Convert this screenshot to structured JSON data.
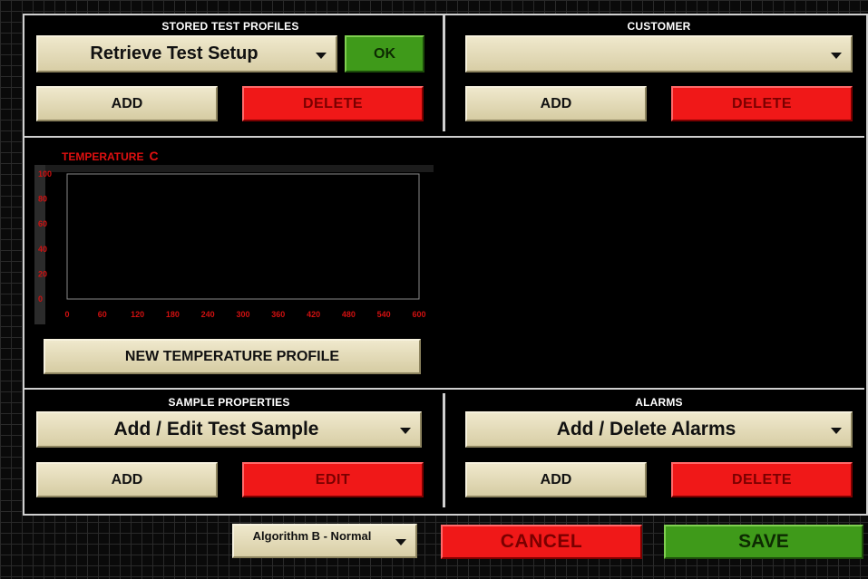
{
  "stored_profiles": {
    "title": "STORED TEST PROFILES",
    "dropdown_value": "Retrieve Test Setup",
    "ok_label": "OK",
    "add_label": "ADD",
    "delete_label": "DELETE"
  },
  "customer": {
    "title": "CUSTOMER",
    "dropdown_value": "",
    "add_label": "ADD",
    "delete_label": "DELETE"
  },
  "temperature": {
    "title": "TEMPERATURE",
    "unit": "C",
    "new_profile_label": "NEW TEMPERATURE PROFILE",
    "chart_data": {
      "type": "line",
      "title": "TEMPERATURE C",
      "x_ticks": [
        0,
        60,
        120,
        180,
        240,
        300,
        360,
        420,
        480,
        540,
        600
      ],
      "y_ticks": [
        0,
        20,
        40,
        60,
        80,
        100
      ],
      "xlim": [
        0,
        600
      ],
      "ylim": [
        0,
        100
      ],
      "series": [],
      "grid": false
    }
  },
  "sample_properties": {
    "title": "SAMPLE PROPERTIES",
    "dropdown_value": "Add / Edit Test Sample",
    "add_label": "ADD",
    "edit_label": "EDIT"
  },
  "alarms": {
    "title": "ALARMS",
    "dropdown_value": "Add / Delete Alarms",
    "add_label": "ADD",
    "delete_label": "DELETE"
  },
  "footer": {
    "algorithm_value": "Algorithm B - Normal",
    "cancel_label": "CANCEL",
    "save_label": "SAVE"
  },
  "colors": {
    "accent_red": "#f01818",
    "accent_green": "#3f9a1a",
    "button_beige": "#e6dfbf",
    "chart_text": "#d01010"
  }
}
